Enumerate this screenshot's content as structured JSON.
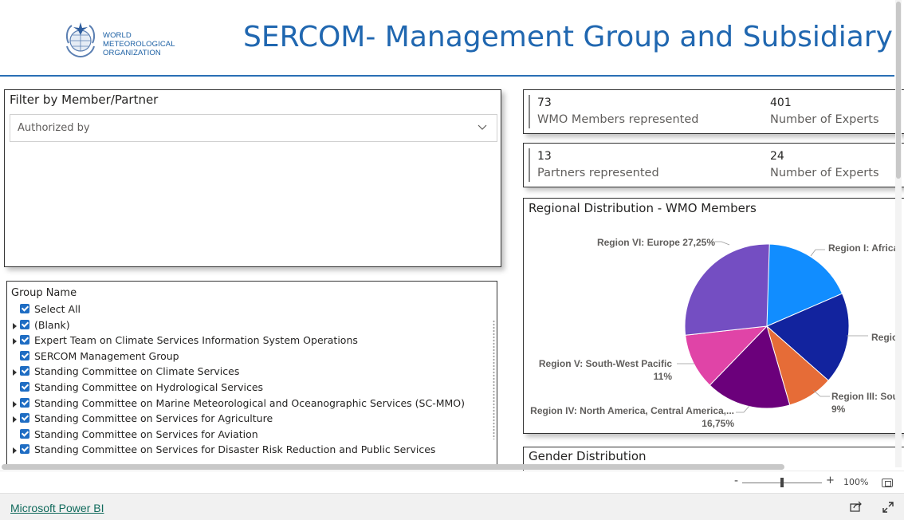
{
  "header": {
    "title": "SERCOM- Management Group and Subsidiary Bodies",
    "logo_lines": [
      "WORLD",
      "METEOROLOGICAL",
      "ORGANIZATION"
    ]
  },
  "filter": {
    "title": "Filter by Member/Partner",
    "dropdown_value": "Authorized by"
  },
  "group_slicer": {
    "header": "Group Name",
    "items": [
      {
        "label": "Select All",
        "expandable": false
      },
      {
        "label": "(Blank)",
        "expandable": true
      },
      {
        "label": "Expert Team on Climate Services Information System Operations",
        "expandable": true
      },
      {
        "label": "SERCOM Management Group",
        "expandable": false
      },
      {
        "label": "Standing Committee on Climate Services",
        "expandable": true
      },
      {
        "label": "Standing Committee on Hydrological Services",
        "expandable": false
      },
      {
        "label": "Standing Committee on Marine Meteorological and Oceanographic Services (SC-MMO)",
        "expandable": true
      },
      {
        "label": "Standing Committee on Services for Agriculture",
        "expandable": true
      },
      {
        "label": "Standing Committee on Services for Aviation",
        "expandable": false
      },
      {
        "label": "Standing Committee on Services for Disaster Risk Reduction and Public Services",
        "expandable": true
      }
    ]
  },
  "kpis": {
    "members": {
      "value": "73",
      "label": "WMO Members represented"
    },
    "member_experts": {
      "value": "401",
      "label": "Number of Experts"
    },
    "partners": {
      "value": "13",
      "label": "Partners represented"
    },
    "partner_experts": {
      "value": "24",
      "label": "Number of Experts"
    }
  },
  "chart_data": {
    "type": "pie",
    "title": "Regional Distribution - WMO Members",
    "slices": [
      {
        "name": "Region I: Africa",
        "percent": 18.5,
        "color": "#118DFF"
      },
      {
        "name": "Region II: Asia",
        "percent": 18.0,
        "color": "#12239E"
      },
      {
        "name": "Region III: South America",
        "percent": 9,
        "color": "#E66C37"
      },
      {
        "name": "Region IV: North America, Central America and the Caribbean",
        "percent": 16.75,
        "color": "#6B007B"
      },
      {
        "name": "Region V: South-West Pacific",
        "percent": 11,
        "color": "#E044A7"
      },
      {
        "name": "Region VI: Europe",
        "percent": 27.25,
        "color": "#744EC2"
      }
    ],
    "labels": {
      "r1": "Region I: Africa",
      "r2": "Regio",
      "r3_name": "Region III: Sou",
      "r3_pct": "9%",
      "r4_name": "Region IV: North America, Central America,...",
      "r4_pct": "16,75%",
      "r5_name": "Region V: South-West Pacific",
      "r5_pct": "11%",
      "r6": "Region VI: Europe 27,25%"
    }
  },
  "gender": {
    "title": "Gender Distribution"
  },
  "footer": {
    "zoom_minus": "-",
    "zoom_plus": "+",
    "zoom": "100%",
    "powerbi_link": "Microsoft Power BI"
  }
}
